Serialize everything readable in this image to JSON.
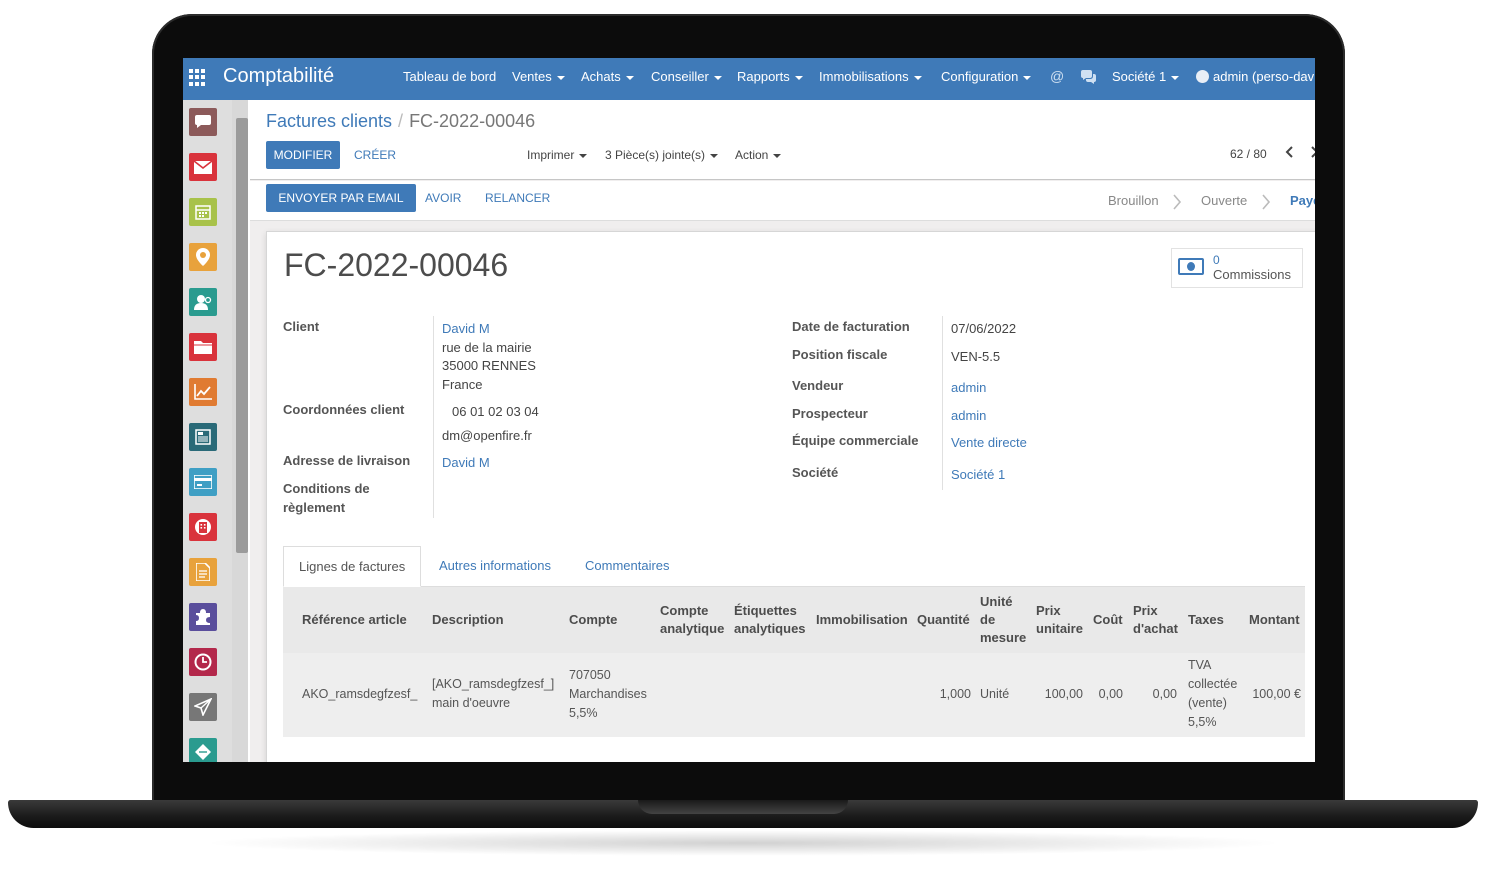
{
  "topbar": {
    "app_title": "Comptabilité",
    "menus": [
      "Tableau de bord",
      "Ventes",
      "Achats",
      "Conseiller",
      "Rapports",
      "Immobilisations",
      "Configuration"
    ],
    "company": "Société 1",
    "user": "admin (perso-dav"
  },
  "sidebar": {
    "icons": [
      {
        "name": "discuss-icon",
        "color": "#8c5a5a"
      },
      {
        "name": "mail-icon",
        "color": "#d9333c"
      },
      {
        "name": "calendar-icon",
        "color": "#a8c24a"
      },
      {
        "name": "map-pin-icon",
        "color": "#e8a23c"
      },
      {
        "name": "contacts-icon",
        "color": "#2a9b8f"
      },
      {
        "name": "folder-icon",
        "color": "#d9333c"
      },
      {
        "name": "chart-icon",
        "color": "#e07b32"
      },
      {
        "name": "invoice-icon",
        "color": "#2a6a78"
      },
      {
        "name": "card-icon",
        "color": "#3f9fc4"
      },
      {
        "name": "building-icon",
        "color": "#d9333c"
      },
      {
        "name": "document-icon",
        "color": "#e8a23c"
      },
      {
        "name": "puzzle-icon",
        "color": "#5a4e9c"
      },
      {
        "name": "clock-icon",
        "color": "#b3284b"
      },
      {
        "name": "send-icon",
        "color": "#777777"
      },
      {
        "name": "ticket-icon",
        "color": "#2a9b8f"
      }
    ]
  },
  "control_panel": {
    "breadcrumb_parent": "Factures clients",
    "breadcrumb_separator": "/",
    "breadcrumb_current": "FC-2022-00046",
    "edit_label": "MODIFIER",
    "create_label": "CRÉER",
    "print_label": "Imprimer",
    "attachments_label": "3 Pièce(s) jointe(s)",
    "action_label": "Action",
    "pager": "62 / 80"
  },
  "statusbar": {
    "email_label": "ENVOYER PAR EMAIL",
    "refund_label": "AVOIR",
    "remind_label": "RELANCER",
    "stages": [
      "Brouillon",
      "Ouverte",
      "Payé"
    ]
  },
  "invoice": {
    "number": "FC-2022-00046",
    "commissions_count": "0",
    "commissions_label": "Commissions",
    "left_fields": {
      "client_label": "Client",
      "client_name": "David M",
      "client_street": "rue de la mairie",
      "client_city": "35000 RENNES",
      "client_country": "France",
      "coords_label": "Coordonnées client",
      "phone": "06 01 02 03 04",
      "email": "dm@openfire.fr",
      "delivery_label": "Adresse de livraison",
      "delivery_value": "David M",
      "terms_label_1": "Conditions de",
      "terms_label_2": "règlement"
    },
    "right_fields": {
      "date_label": "Date de facturation",
      "date_value": "07/06/2022",
      "fiscal_label": "Position fiscale",
      "fiscal_value": "VEN-5.5",
      "seller_label": "Vendeur",
      "seller_value": "admin",
      "prospector_label": "Prospecteur",
      "prospector_value": "admin",
      "team_label": "Équipe commerciale",
      "team_value": "Vente directe",
      "company_label": "Société",
      "company_value": "Société 1"
    }
  },
  "tabs": [
    "Lignes de factures",
    "Autres informations",
    "Commentaires"
  ],
  "lines_table": {
    "headers": [
      [
        "Référence article"
      ],
      [
        "Description"
      ],
      [
        "Compte"
      ],
      [
        "Compte",
        "analytique"
      ],
      [
        "Étiquettes",
        "analytiques"
      ],
      [
        "Immobilisation"
      ],
      [
        "Quantité"
      ],
      [
        "Unité",
        "de",
        "mesure"
      ],
      [
        "Prix",
        "unitaire"
      ],
      [
        "Coût"
      ],
      [
        "Prix",
        "d'achat"
      ],
      [
        "Taxes"
      ],
      [
        "Montant"
      ]
    ],
    "row": {
      "ref": "AKO_ramsdegfzesf_",
      "description": [
        "[AKO_ramsdegfzesf_]",
        "main d'oeuvre"
      ],
      "account": [
        "707050",
        "Marchandises",
        "5,5%"
      ],
      "quantity": "1,000",
      "uom": "Unité",
      "unit_price": "100,00",
      "cost": "0,00",
      "purchase_price": "0,00",
      "taxes": [
        "TVA",
        "collectée",
        "(vente)",
        "5,5%"
      ],
      "amount": "100,00 €"
    }
  },
  "colors": {
    "brand": "#3f7ab8",
    "navbar": "#3f7ab8",
    "sidebar": "#dedede",
    "background": "#f0eeee"
  }
}
